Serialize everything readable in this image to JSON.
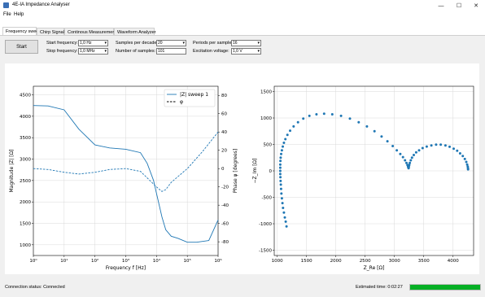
{
  "window": {
    "title": "4E-IA Impedance Analyser",
    "minimize_glyph": "—",
    "maximize_glyph": "☐",
    "close_glyph": "✕"
  },
  "menu": [
    "File",
    "Help"
  ],
  "tabs": [
    "Frequency sweep",
    "Chirp Signal",
    "Continous Measurement",
    "Waveform Analyzer"
  ],
  "controls": {
    "start_label": "Start",
    "start_frequency": {
      "label": "Start frequency:",
      "value": "1,0 Hz"
    },
    "stop_frequency": {
      "label": "Stop frequency:",
      "value": "1,0 MHz"
    },
    "samples_per_decade": {
      "label": "Samples per decade:",
      "value": "20"
    },
    "number_of_samples": {
      "label": "Number of samples:",
      "value": "101"
    },
    "periods_per_sample": {
      "label": "Periods per sample:",
      "value": "16"
    },
    "excitation_voltage": {
      "label": "Excitation voltage:",
      "value": "1,0 V"
    }
  },
  "status": {
    "connection": "Connection status: Connected",
    "estimated_time": "Estimated time: 0:02:27",
    "progress_fraction": 1.0,
    "progress_color": "#06b025"
  },
  "chart_data": [
    {
      "type": "line",
      "xlabel": "Frequency f [Hz]",
      "ylabel": "Magnitude |Z| [Ω]",
      "y2label": "Phase φ [degrees]",
      "xscale": "log",
      "xlim": [
        1,
        1000000
      ],
      "ylim": [
        750,
        4700
      ],
      "y2lim": [
        -95,
        90
      ],
      "x_ticks": [
        "10⁰",
        "10¹",
        "10²",
        "10³",
        "10⁴",
        "10⁵",
        "10⁶"
      ],
      "y_ticks": [
        1000,
        1500,
        2000,
        2500,
        3000,
        3500,
        4000,
        4500
      ],
      "y2_ticks": [
        -80,
        -60,
        -40,
        -20,
        0,
        20,
        40,
        60,
        80
      ],
      "legend_position": "top-right",
      "grid": true,
      "series": [
        {
          "name": "|Z| sweep 1",
          "axis": "left",
          "style": "solid",
          "color": "#1f77b4",
          "x": [
            1,
            3,
            10,
            30,
            100,
            300,
            1000,
            3000,
            5000,
            8000,
            10000,
            15000,
            20000,
            30000,
            50000,
            100000,
            200000,
            500000,
            1000000
          ],
          "y": [
            4250,
            4240,
            4150,
            3700,
            3330,
            3260,
            3230,
            3150,
            2900,
            2500,
            2200,
            1650,
            1350,
            1200,
            1150,
            1060,
            1060,
            1100,
            1580
          ]
        },
        {
          "name": "φ",
          "axis": "right",
          "style": "dashed",
          "color": "#1f77b4",
          "x": [
            1,
            3,
            10,
            30,
            100,
            300,
            1000,
            3000,
            10000,
            15000,
            20000,
            30000,
            100000,
            300000,
            1000000
          ],
          "y": [
            0,
            -1,
            -4,
            -6,
            -4,
            -1,
            0,
            -3,
            -20,
            -25,
            -23,
            -15,
            0,
            18,
            40
          ]
        }
      ]
    },
    {
      "type": "scatter",
      "xlabel": "Z_Re [Ω]",
      "ylabel": "−Z_Im [Ω]",
      "xlim": [
        950,
        4350
      ],
      "ylim": [
        -1600,
        1600
      ],
      "x_ticks": [
        1000,
        1500,
        2000,
        2500,
        3000,
        3500,
        4000
      ],
      "y_ticks": [
        -1500,
        -1000,
        -500,
        0,
        500,
        1000,
        1500
      ],
      "grid": true,
      "series": [
        {
          "color": "#1f77b4",
          "x": [
            1160,
            1145,
            1130,
            1115,
            1100,
            1090,
            1080,
            1072,
            1066,
            1062,
            1058,
            1055,
            1053,
            1052,
            1052,
            1053,
            1055,
            1060,
            1068,
            1080,
            1096,
            1115,
            1140,
            1175,
            1220,
            1280,
            1355,
            1445,
            1550,
            1670,
            1800,
            1940,
            2090,
            2240,
            2390,
            2530,
            2660,
            2780,
            2880,
            2970,
            3040,
            3100,
            3145,
            3180,
            3205,
            3222,
            3232,
            3238,
            3241,
            3243,
            3246,
            3252,
            3262,
            3278,
            3300,
            3330,
            3370,
            3420,
            3480,
            3550,
            3630,
            3710,
            3790,
            3870,
            3940,
            4010,
            4070,
            4120,
            4165,
            4200,
            4225,
            4240,
            4250,
            4254,
            4256
          ],
          "y": [
            -1050,
            -960,
            -880,
            -790,
            -700,
            -610,
            -520,
            -430,
            -340,
            -260,
            -190,
            -120,
            -60,
            0,
            60,
            120,
            190,
            250,
            320,
            390,
            460,
            530,
            600,
            680,
            760,
            840,
            920,
            990,
            1040,
            1070,
            1080,
            1070,
            1040,
            990,
            920,
            840,
            750,
            650,
            560,
            470,
            390,
            320,
            260,
            200,
            150,
            110,
            80,
            60,
            50,
            60,
            80,
            110,
            150,
            200,
            250,
            300,
            350,
            390,
            430,
            460,
            480,
            495,
            495,
            480,
            455,
            420,
            380,
            330,
            280,
            225,
            170,
            120,
            80,
            50,
            30
          ]
        }
      ]
    }
  ]
}
